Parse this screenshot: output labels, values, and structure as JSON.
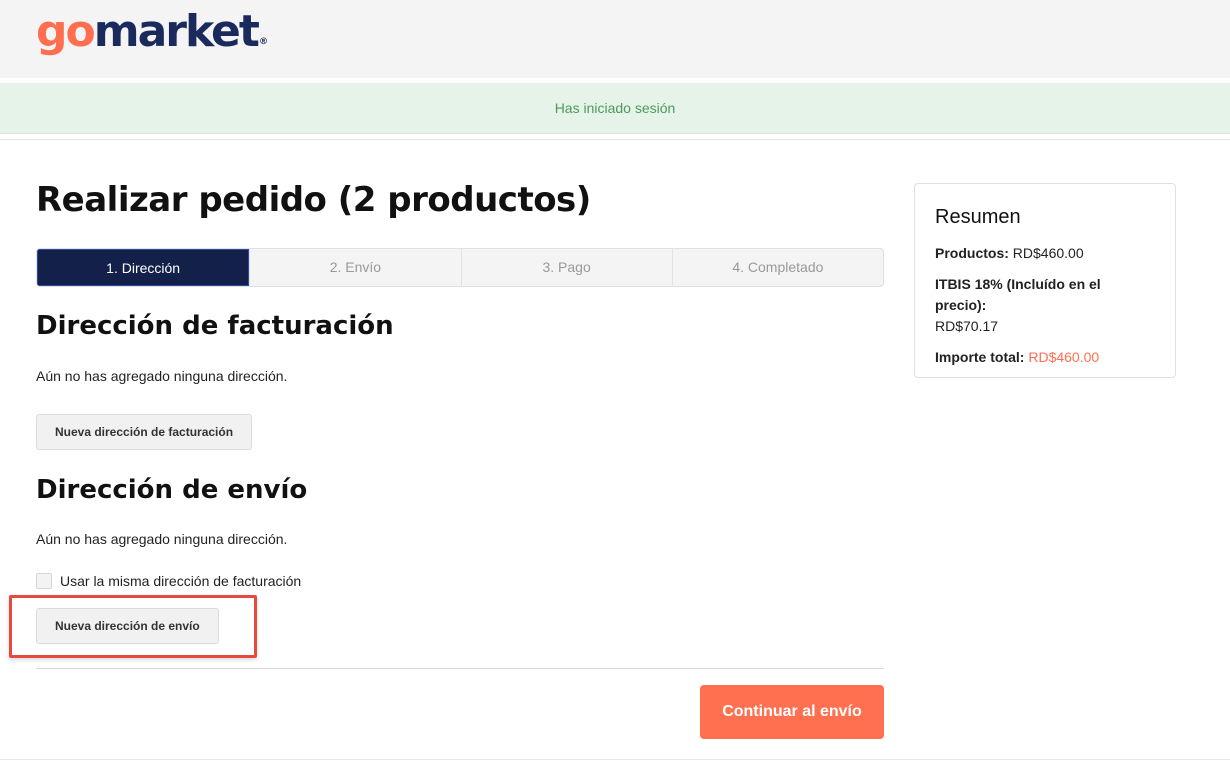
{
  "header": {
    "logo_go": "go",
    "logo_market": "market",
    "logo_reg": "®"
  },
  "alert": {
    "message": "Has iniciado sesión"
  },
  "page": {
    "title": "Realizar pedido (2 productos)"
  },
  "steps": [
    {
      "label": "1. Dirección",
      "active": true
    },
    {
      "label": "2. Envío",
      "active": false
    },
    {
      "label": "3. Pago",
      "active": false
    },
    {
      "label": "4. Completado",
      "active": false
    }
  ],
  "billing": {
    "title": "Dirección de facturación",
    "empty_text": "Aún no has agregado ninguna dirección.",
    "new_button": "Nueva dirección de facturación"
  },
  "shipping": {
    "title": "Dirección de envío",
    "empty_text": "Aún no has agregado ninguna dirección.",
    "same_as_billing_label": "Usar la misma dirección de facturación",
    "same_as_billing_checked": false,
    "new_button": "Nueva dirección de envío"
  },
  "actions": {
    "continue_label": "Continuar al envío"
  },
  "summary": {
    "title": "Resumen",
    "products_label": "Productos:",
    "products_value": "RD$460.00",
    "tax_label": "ITBIS 18% (Incluído en el precio):",
    "tax_value": "RD$70.17",
    "total_label": "Importe total:",
    "total_value": "RD$460.00"
  },
  "colors": {
    "accent": "#ff7050",
    "brand_navy": "#13204a",
    "success_text": "#4c9a5a",
    "success_bg": "#e6f3e8",
    "highlight": "#e8493f"
  }
}
